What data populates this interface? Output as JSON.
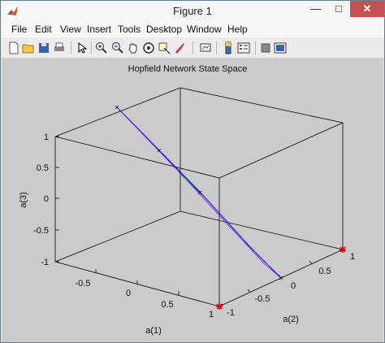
{
  "window": {
    "title": "Figure 1",
    "minimize": "—",
    "maximize": "□",
    "close": "✕"
  },
  "menu": [
    "File",
    "Edit",
    "View",
    "Insert",
    "Tools",
    "Desktop",
    "Window",
    "Help"
  ],
  "toolbar": [
    "new-figure-icon",
    "open-file-icon",
    "save-icon",
    "print-icon",
    "pointer-icon",
    "zoom-in-icon",
    "zoom-out-icon",
    "pan-hand-icon",
    "rotate-3d-icon",
    "data-cursor-icon",
    "brush-icon",
    "link-plot-icon",
    "colorbar-icon",
    "legend-icon",
    "hide-plot-tools-icon",
    "show-plot-tools-icon"
  ],
  "colors": {
    "trajectory": "#0000ff",
    "trajectory2": "#8000ff",
    "endpoint": "#e00000"
  },
  "chart_data": {
    "type": "line3d",
    "title": "Hopfield Network State Space",
    "xlabel": "a(1)",
    "ylabel": "a(2)",
    "zlabel": "a(3)",
    "xlim": [
      -1,
      1
    ],
    "ylim": [
      -1,
      1
    ],
    "zlim": [
      -1,
      1
    ],
    "xticks": [
      "-0.5",
      "0",
      "0.5",
      "1"
    ],
    "yticks": [
      "-1",
      "-0.5",
      "0",
      "0.5",
      "1"
    ],
    "zticks": [
      "-1",
      "-0.5",
      "0",
      "0.5",
      "1"
    ],
    "grid": false,
    "series": [
      {
        "x": [
          -1,
          -0.6,
          0.1,
          0.6,
          1
        ],
        "y": [
          -1,
          -0.6,
          -0.1,
          0.6,
          1
        ],
        "z": [
          1,
          0.6,
          0.1,
          -0.6,
          -1
        ]
      },
      {
        "x": [
          -0.8,
          -0.3,
          0.2,
          0.7,
          1
        ],
        "y": [
          -0.8,
          -0.3,
          0.2,
          0.7,
          1
        ],
        "z": [
          0.8,
          0.3,
          -0.2,
          -0.7,
          -1
        ]
      }
    ],
    "endpoints": [
      {
        "x": 1,
        "y": -1,
        "z": -1
      },
      {
        "x": 1,
        "y": 1,
        "z": -1
      }
    ]
  }
}
